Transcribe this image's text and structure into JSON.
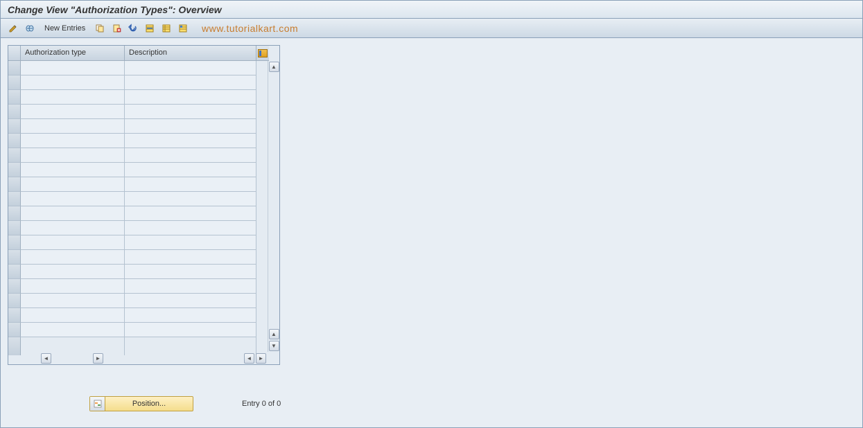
{
  "header": {
    "title": "Change View \"Authorization Types\": Overview"
  },
  "toolbar": {
    "new_entries_label": "New Entries"
  },
  "watermark": "www.tutorialkart.com",
  "table": {
    "columns": {
      "auth": "Authorization type",
      "desc": "Description"
    },
    "rows": [
      {
        "auth": "",
        "desc": ""
      },
      {
        "auth": "",
        "desc": ""
      },
      {
        "auth": "",
        "desc": ""
      },
      {
        "auth": "",
        "desc": ""
      },
      {
        "auth": "",
        "desc": ""
      },
      {
        "auth": "",
        "desc": ""
      },
      {
        "auth": "",
        "desc": ""
      },
      {
        "auth": "",
        "desc": ""
      },
      {
        "auth": "",
        "desc": ""
      },
      {
        "auth": "",
        "desc": ""
      },
      {
        "auth": "",
        "desc": ""
      },
      {
        "auth": "",
        "desc": ""
      },
      {
        "auth": "",
        "desc": ""
      },
      {
        "auth": "",
        "desc": ""
      },
      {
        "auth": "",
        "desc": ""
      },
      {
        "auth": "",
        "desc": ""
      },
      {
        "auth": "",
        "desc": ""
      },
      {
        "auth": "",
        "desc": ""
      },
      {
        "auth": "",
        "desc": ""
      }
    ]
  },
  "footer": {
    "position_label": "Position...",
    "entry_label": "Entry 0 of 0"
  }
}
